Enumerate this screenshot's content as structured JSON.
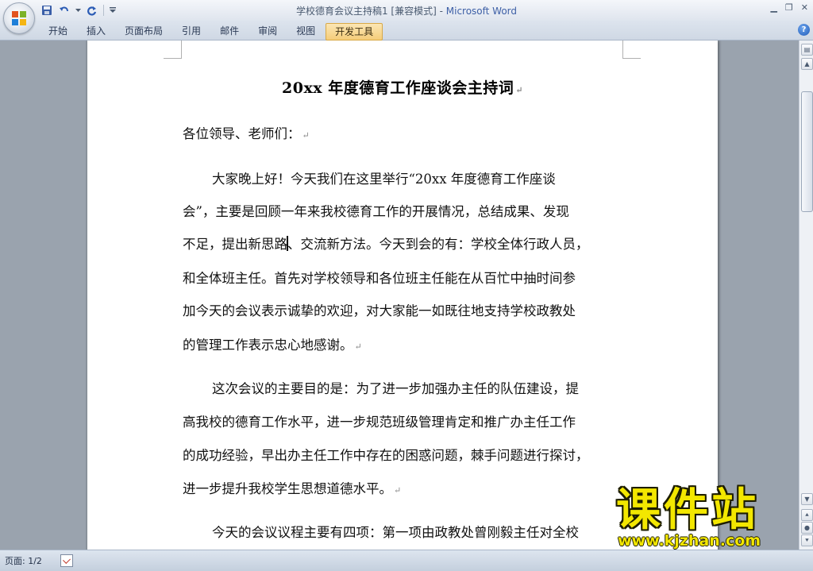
{
  "window": {
    "doc_title": "学校德育会议主持稿1 [兼容模式]",
    "title_separator": " - ",
    "app_name": "Microsoft Word"
  },
  "ribbon": {
    "tabs": [
      {
        "label": "开始"
      },
      {
        "label": "插入"
      },
      {
        "label": "页面布局"
      },
      {
        "label": "引用"
      },
      {
        "label": "邮件"
      },
      {
        "label": "审阅"
      },
      {
        "label": "视图"
      },
      {
        "label": "开发工具",
        "active": true
      }
    ],
    "help_label": "?"
  },
  "document": {
    "heading": "20xx 年度德育工作座谈会主持词",
    "greeting": "各位领导、老师们：",
    "lines": [
      "大家晚上好！今天我们在这里举行“20xx 年度德育工作座谈",
      "会”，主要是回顾一年来我校德育工作的开展情况，总结成果、发现",
      "不足，提出新思路",
      "、交流新方法。今天到会的有：学校全体行政人员，",
      "和全体班主任。首先对学校领导和各位班主任能在从百忙中抽时间参",
      "加今天的会议表示诚挚的欢迎，对大家能一如既往地支持学校政教处",
      "的管理工作表示忠心地感谢。",
      "这次会议的主要目的是：为了进一步加强办主任的队伍建设，提",
      "高我校的德育工作水平，进一步规范班级管理肯定和推广办主任工作",
      "的成功经验，早出办主任工作中存在的困惑问题，棘手问题进行探讨，",
      "进一步提升我校学生思想道德水平。",
      "今天的会议议程主要有四项：第一项由政教处曾刚毅主任对全校"
    ],
    "para_mark": "↵"
  },
  "status": {
    "page_label": "页面: 1/2"
  },
  "watermark": {
    "title": "课件站",
    "url": "www.kjzhan.com"
  },
  "colors": {
    "app_name": "#3d5fa6",
    "active_tab": "#f5cd7a",
    "watermark": "#f3e700"
  }
}
